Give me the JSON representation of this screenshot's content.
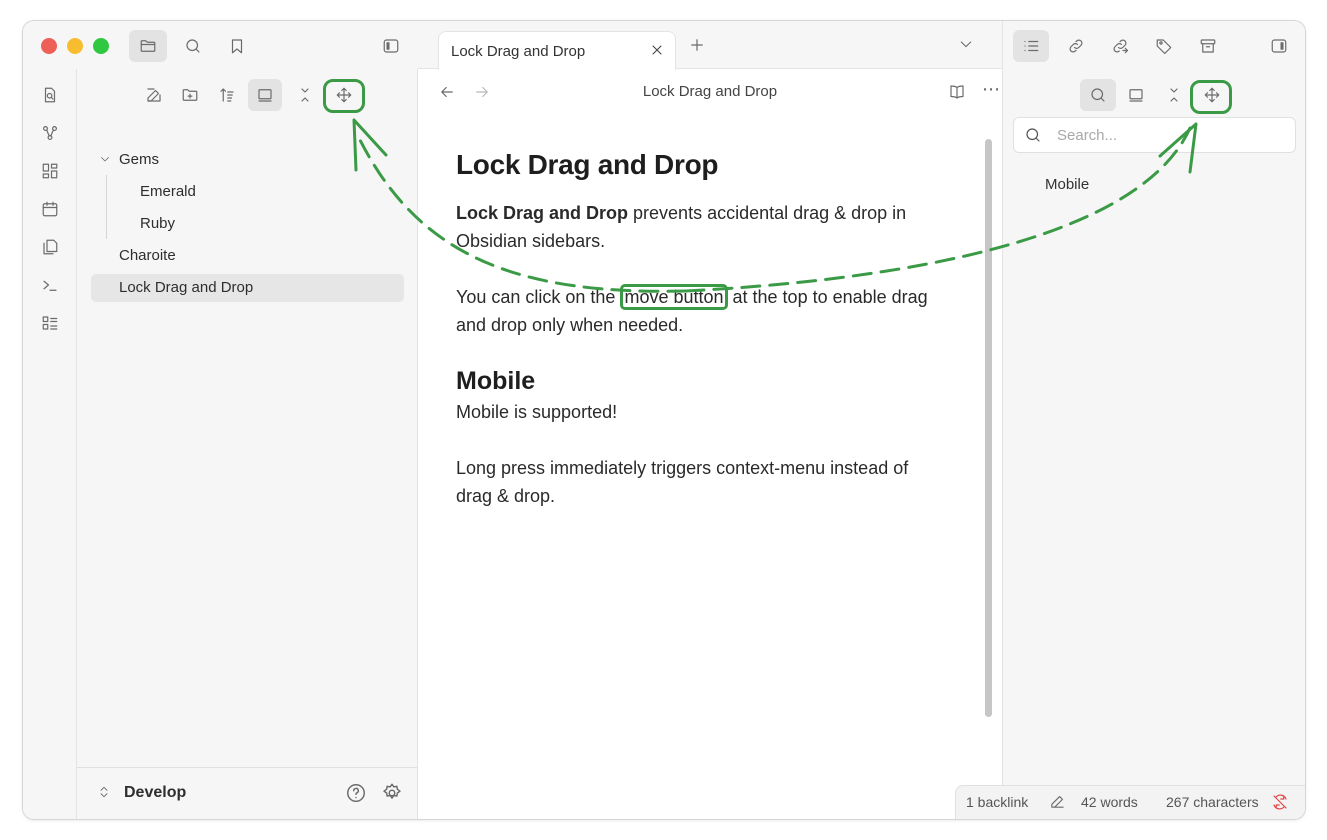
{
  "left_sidebar": {
    "tree": [
      {
        "label": "Gems",
        "type": "folder",
        "expanded": true
      },
      {
        "label": "Emerald",
        "type": "file"
      },
      {
        "label": "Ruby",
        "type": "file"
      },
      {
        "label": "Charoite",
        "type": "file"
      },
      {
        "label": "Lock Drag and Drop",
        "type": "file",
        "selected": true
      }
    ],
    "vault_name": "Develop"
  },
  "tabs": [
    {
      "label": "Lock Drag and Drop",
      "active": true
    }
  ],
  "note": {
    "breadcrumb_title": "Lock Drag and Drop",
    "h1": "Lock Drag and Drop",
    "p1_bold": "Lock Drag and Drop",
    "p1_rest": " prevents accidental drag & drop in Obsidian sidebars.",
    "p2_before": "You can click on the ",
    "p2_highlight": "move button",
    "p2_after": " at the top to enable drag and drop only when needed.",
    "h2": "Mobile",
    "p3": "Mobile is supported!",
    "p4": "Long press immediately triggers context-menu instead of drag & drop."
  },
  "right_sidebar": {
    "search_placeholder": "Search...",
    "results": [
      "Mobile"
    ]
  },
  "status_bar": {
    "backlinks": "1 backlink",
    "words": "42 words",
    "characters": "267 characters"
  },
  "colors": {
    "annotation_green": "#3a9a45",
    "traffic_red": "#ee5f58",
    "traffic_yellow": "#f8bd2e",
    "traffic_green": "#2fc840"
  }
}
